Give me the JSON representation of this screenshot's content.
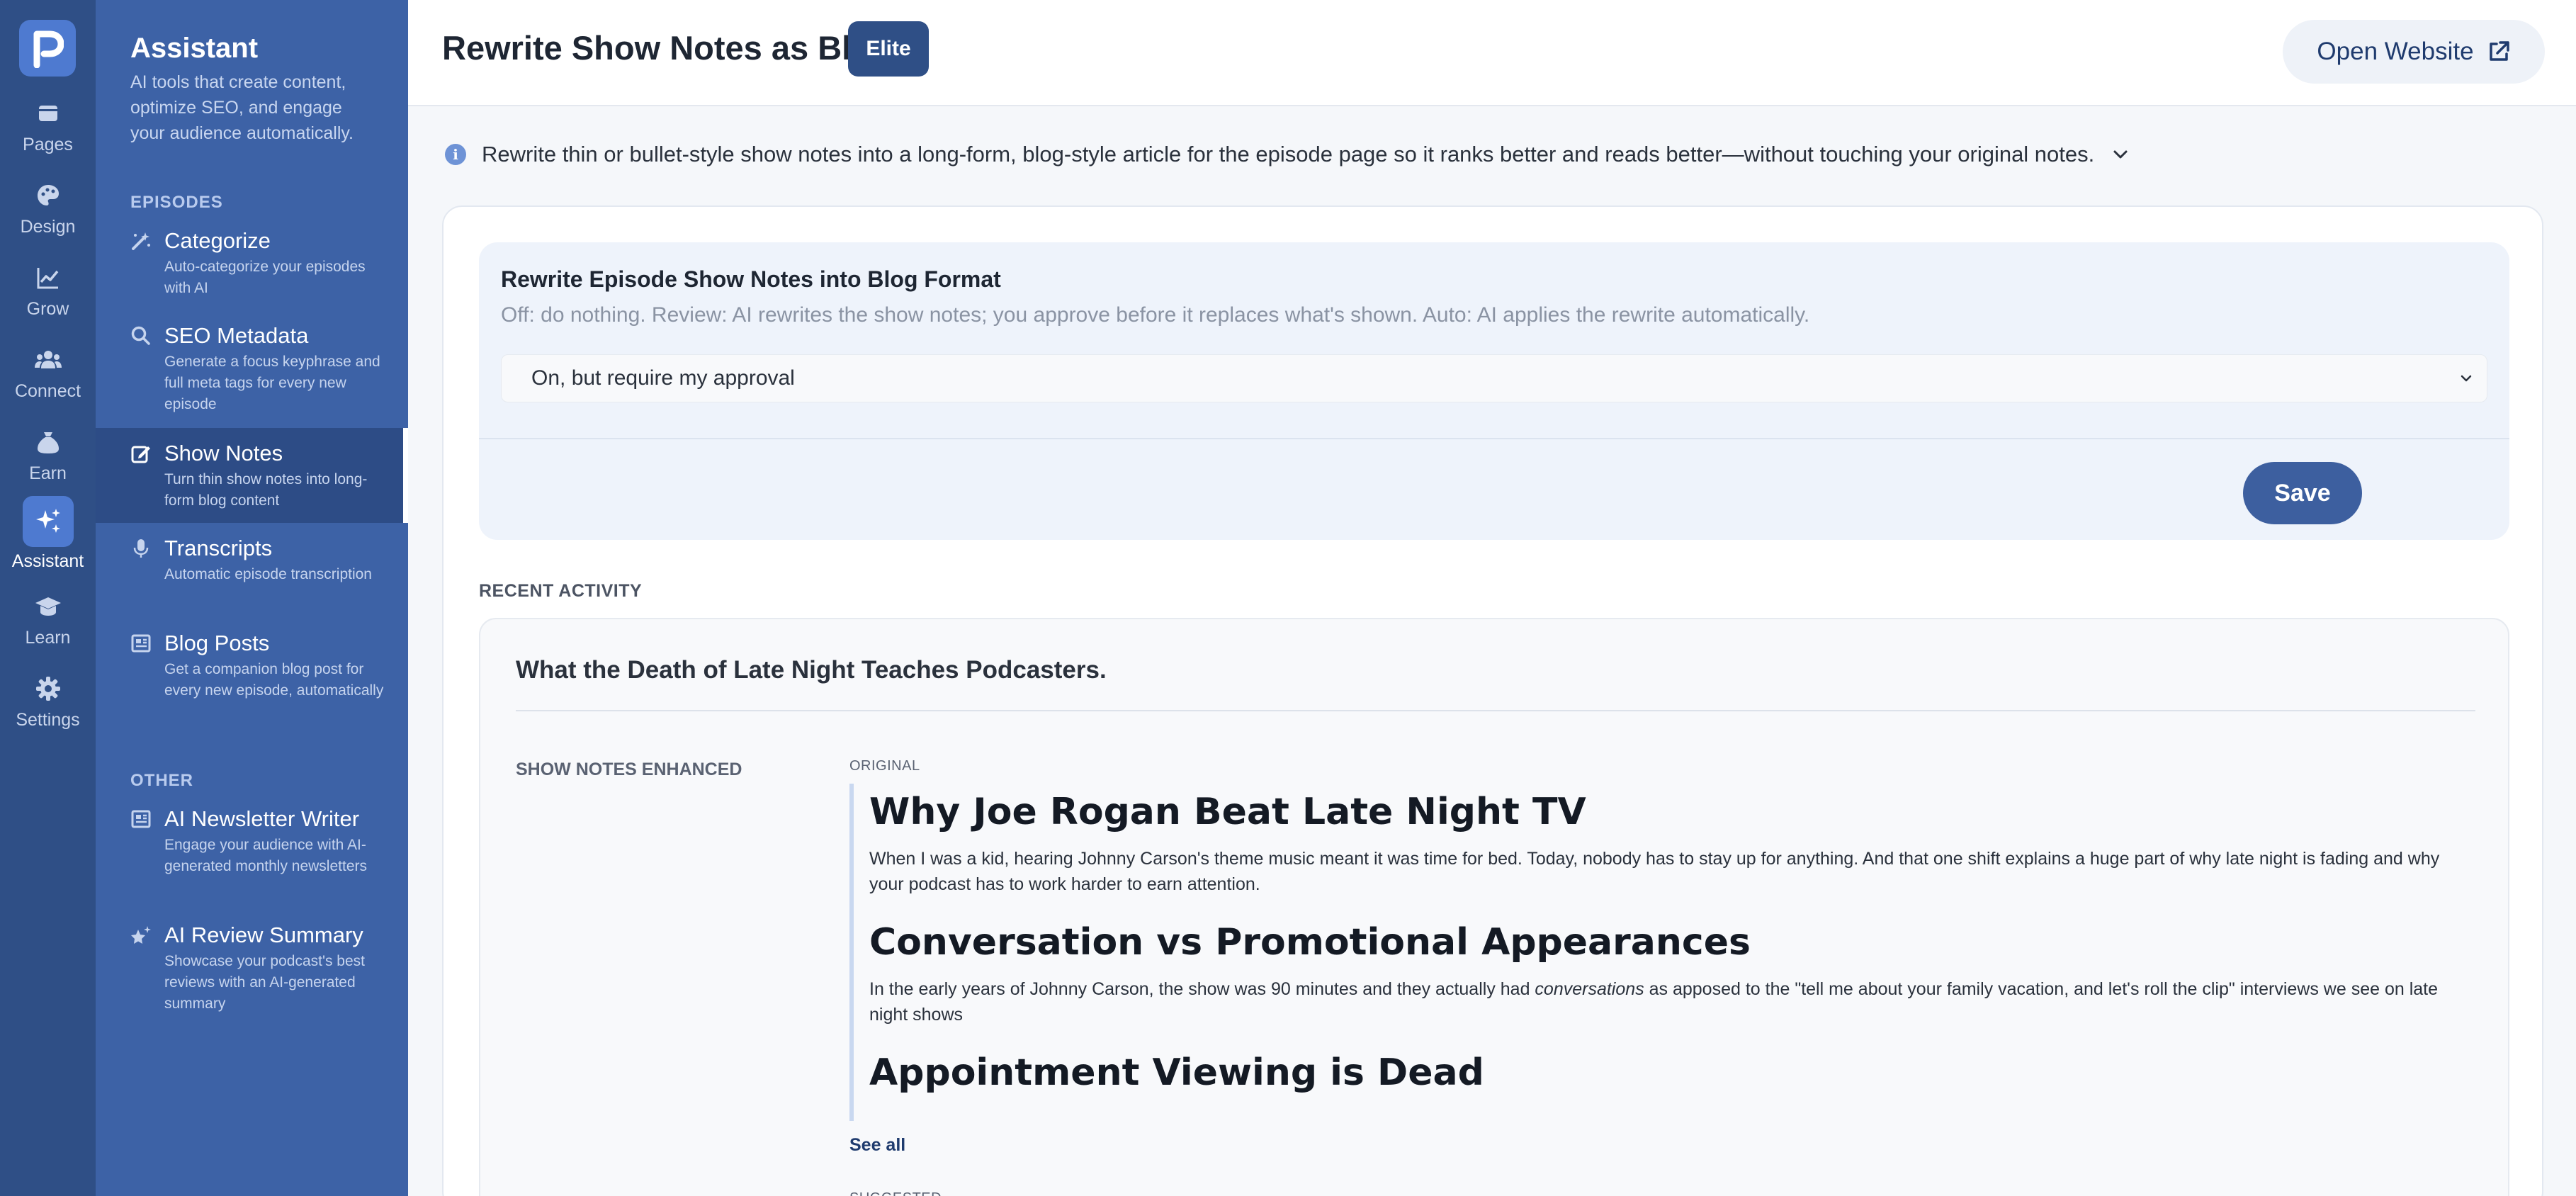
{
  "rail": {
    "items": [
      {
        "label": "Pages",
        "icon": "pages-icon"
      },
      {
        "label": "Design",
        "icon": "palette-icon"
      },
      {
        "label": "Grow",
        "icon": "chart-line-icon"
      },
      {
        "label": "Connect",
        "icon": "users-icon"
      },
      {
        "label": "Earn",
        "icon": "money-bag-icon"
      },
      {
        "label": "Assistant",
        "icon": "sparkles-icon",
        "active": true
      },
      {
        "label": "Learn",
        "icon": "graduation-cap-icon"
      },
      {
        "label": "Settings",
        "icon": "gear-icon"
      }
    ]
  },
  "sidebar": {
    "title": "Assistant",
    "description": "AI tools that create content, optimize SEO, and engage your audience automatically.",
    "sections": [
      {
        "heading": "EPISODES"
      },
      {
        "heading": "OTHER"
      }
    ],
    "items": [
      {
        "name": "Categorize",
        "sub": "Auto-categorize your episodes with AI",
        "icon": "magic-wand-icon"
      },
      {
        "name": "SEO Metadata",
        "sub": "Generate a focus keyphrase and full meta tags for every new episode",
        "icon": "search-icon"
      },
      {
        "name": "Show Notes",
        "sub": "Turn thin show notes into long-form blog content",
        "icon": "edit-icon",
        "active": true
      },
      {
        "name": "Transcripts",
        "sub": "Automatic episode transcription",
        "icon": "microphone-icon"
      },
      {
        "name": "Blog Posts",
        "sub": "Get a companion blog post for every new episode, automatically",
        "icon": "newspaper-icon"
      },
      {
        "name": "AI Newsletter Writer",
        "sub": "Engage your audience with AI-generated monthly newsletters",
        "icon": "newsletter-icon"
      },
      {
        "name": "AI Review Summary",
        "sub": "Showcase your podcast's best reviews with an AI-generated summary",
        "icon": "star-sparkle-icon"
      }
    ]
  },
  "header": {
    "title": "Rewrite Show Notes as Blog",
    "badge": "Elite",
    "open_website": "Open Website"
  },
  "info": {
    "text": "Rewrite thin or bullet-style show notes into a long-form, blog-style article for the episode page so it ranks better and reads better—without touching your original notes."
  },
  "setting": {
    "title": "Rewrite Episode Show Notes into Blog Format",
    "description": "Off: do nothing. Review: AI rewrites the show notes; you approve before it replaces what's shown. Auto: AI applies the rewrite automatically.",
    "selected": "On, but require my approval",
    "save_label": "Save"
  },
  "recent": {
    "label": "RECENT ACTIVITY",
    "item": {
      "title": "What the Death of Late Night Teaches Podcasters.",
      "type_label": "SHOW NOTES ENHANCED",
      "original_label": "ORIGINAL",
      "original": {
        "h1": "Why Joe Rogan Beat Late Night TV",
        "p1": "When I was a kid, hearing Johnny Carson's theme music meant it was time for bed. Today, nobody has to stay up for anything. And that one shift explains a huge part of why late night is fading and why your podcast has to work harder to earn attention.",
        "h2": "Conversation vs Promotional Appearances",
        "p2_before": "In the early years of Johnny Carson, the show was 90 minutes and they actually had ",
        "p2_em": "conversations",
        "p2_after": " as apposed to the \"tell me about your family vacation, and let's roll the clip\" interviews we see on late night shows",
        "h3": "Appointment Viewing is Dead"
      },
      "see_all": "See all",
      "suggested_label": "SUGGESTED"
    }
  }
}
